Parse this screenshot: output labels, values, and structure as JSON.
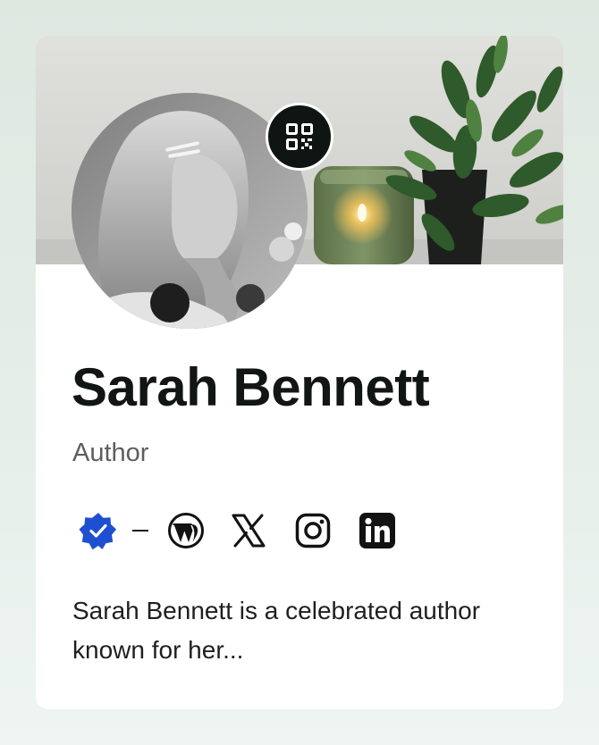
{
  "profile": {
    "name": "Sarah Bennett",
    "role": "Author",
    "bio": "Sarah Bennett is a celebrated author known for her..."
  },
  "actions": {
    "qr_icon": "qr-code-icon"
  },
  "badges": {
    "verified_icon": "verified-badge-icon",
    "verified_color": "#1f4fd1"
  },
  "socials": [
    {
      "icon": "wordpress-icon"
    },
    {
      "icon": "x-icon"
    },
    {
      "icon": "instagram-icon"
    },
    {
      "icon": "linkedin-icon"
    }
  ],
  "colors": {
    "name_text": "#111513",
    "role_text": "#5c5f5d",
    "card_background": "#ffffff",
    "qr_button": "#0f1512"
  }
}
